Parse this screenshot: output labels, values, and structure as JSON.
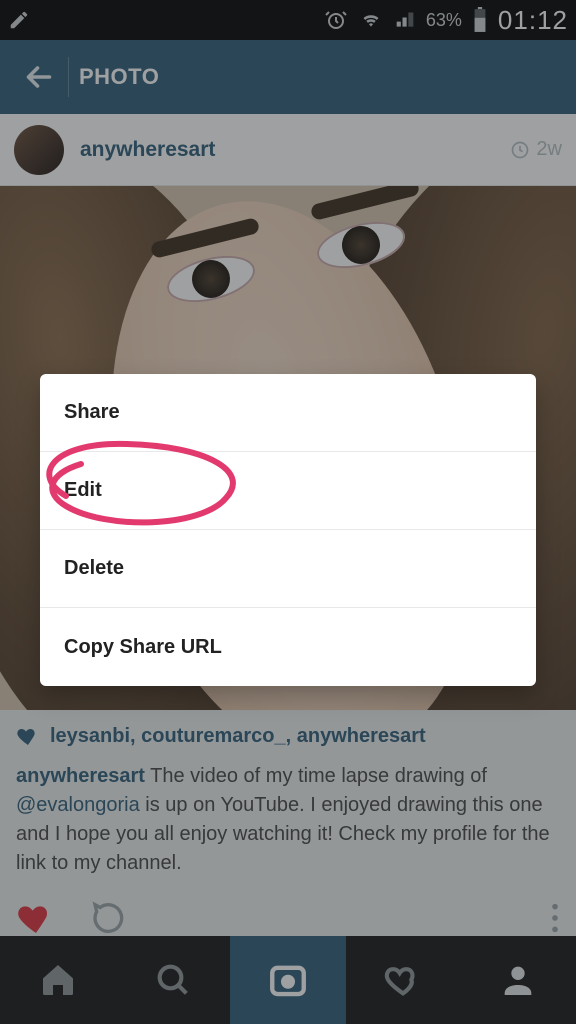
{
  "status": {
    "battery_pct": "63%",
    "clock": "01:12"
  },
  "header": {
    "title": "PHOTO"
  },
  "post": {
    "username": "anywheresart",
    "timestamp": "2w",
    "likers": "leysanbi, couturemarco_, anywheresart",
    "caption_user": "anywheresart",
    "caption_pre": " The video of my time lapse drawing of ",
    "caption_mention": "@evalongoria",
    "caption_post": " is up on YouTube.  I enjoyed drawing this one and I hope you all enjoy watching it! Check my profile for the link to my channel."
  },
  "dialog": {
    "items": [
      "Share",
      "Edit",
      "Delete",
      "Copy Share URL"
    ]
  }
}
